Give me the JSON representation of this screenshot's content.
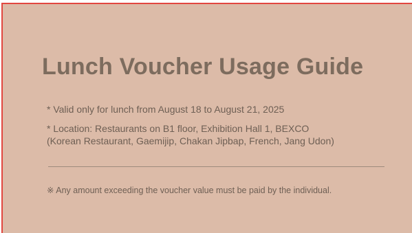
{
  "guide": {
    "title": "Lunch Voucher Usage Guide",
    "validity": "* Valid only for lunch from August 18 to August 21, 2025",
    "location_line1": "* Location: Restaurants on B1 floor, Exhibition Hall 1, BEXCO",
    "location_line2": "(Korean Restaurant, Gaemijip, Chakan Jipbap, French, Jang Udon)",
    "note": "※ Any amount exceeding the voucher value must be paid by the individual."
  },
  "colors": {
    "panel_background": "#dcbba8",
    "border_accent": "#e2463f",
    "title_text": "#7d6c5e",
    "body_text": "#6e5f54"
  }
}
